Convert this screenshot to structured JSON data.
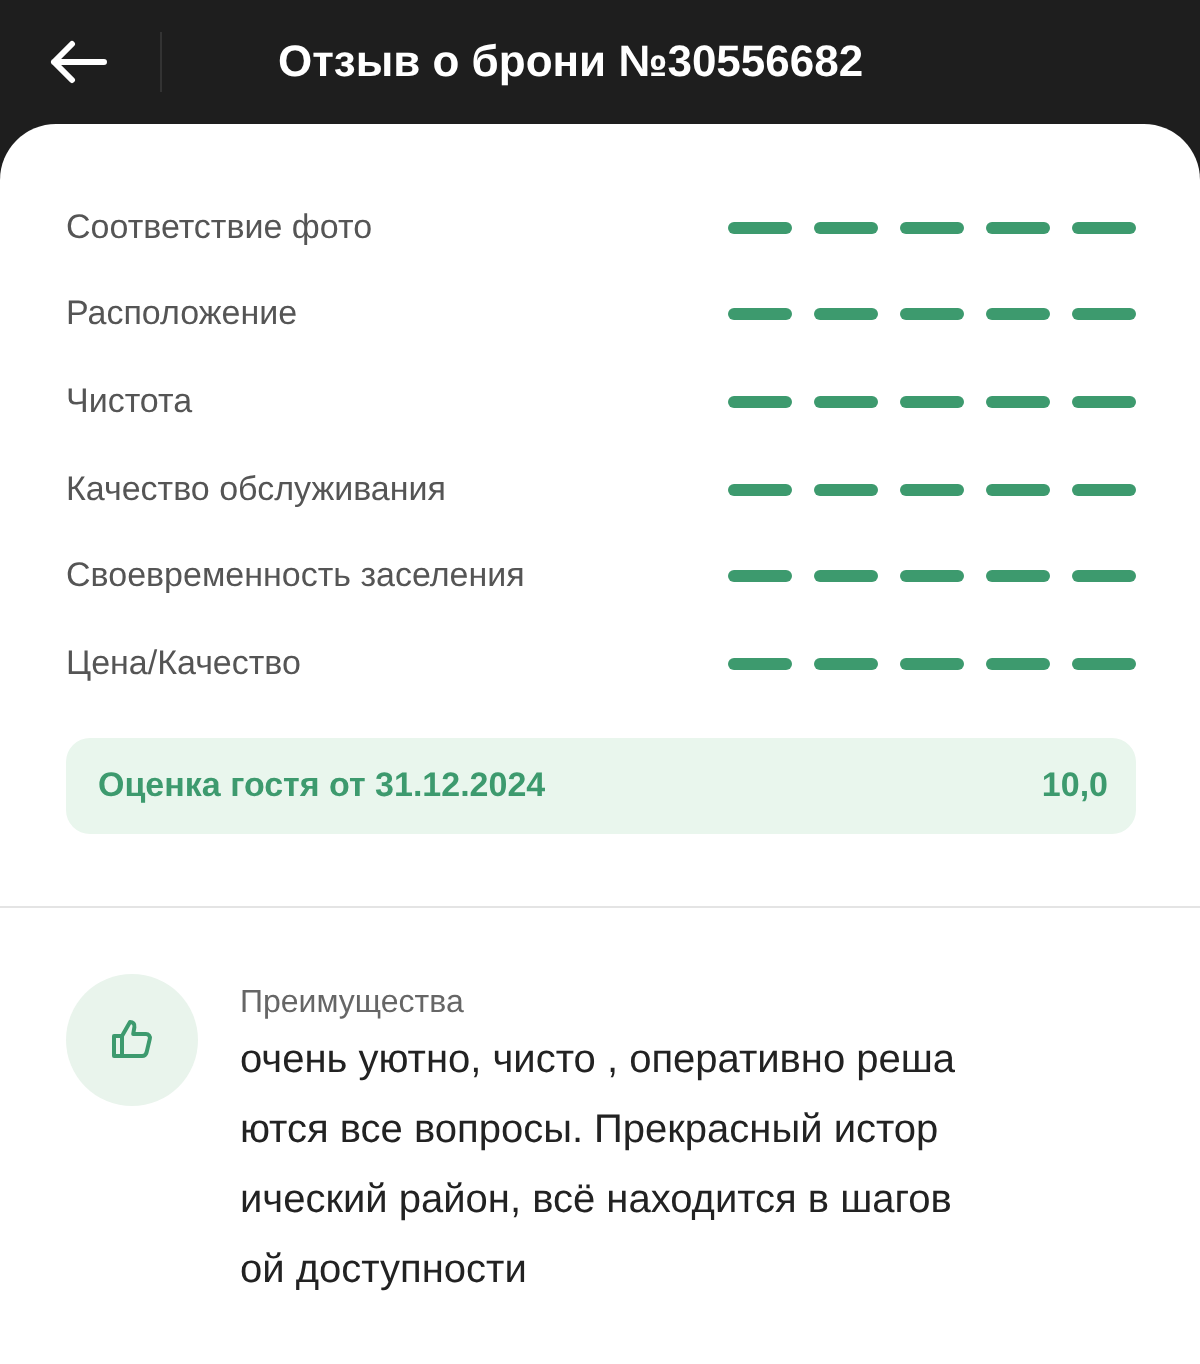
{
  "header": {
    "title": "Отзыв о брони №30556682"
  },
  "ratings": [
    {
      "label": "Соответствие фото",
      "stars": 5
    },
    {
      "label": "Расположение",
      "stars": 5
    },
    {
      "label": "Чистота",
      "stars": 5
    },
    {
      "label": "Качество обслуживания",
      "stars": 5
    },
    {
      "label": "Своевременность заселения",
      "stars": 5
    },
    {
      "label": "Цена/Качество",
      "stars": 5
    }
  ],
  "guest_score": {
    "label": "Оценка гостя от 31.12.2024",
    "value": "10,0"
  },
  "pros": {
    "title": "Преимущества",
    "lines": [
      "очень уютно, чисто , оперативно реша",
      "ются все вопросы. Прекрасный истор",
      "ический район, всё находится в шагов",
      "ой доступности"
    ]
  }
}
